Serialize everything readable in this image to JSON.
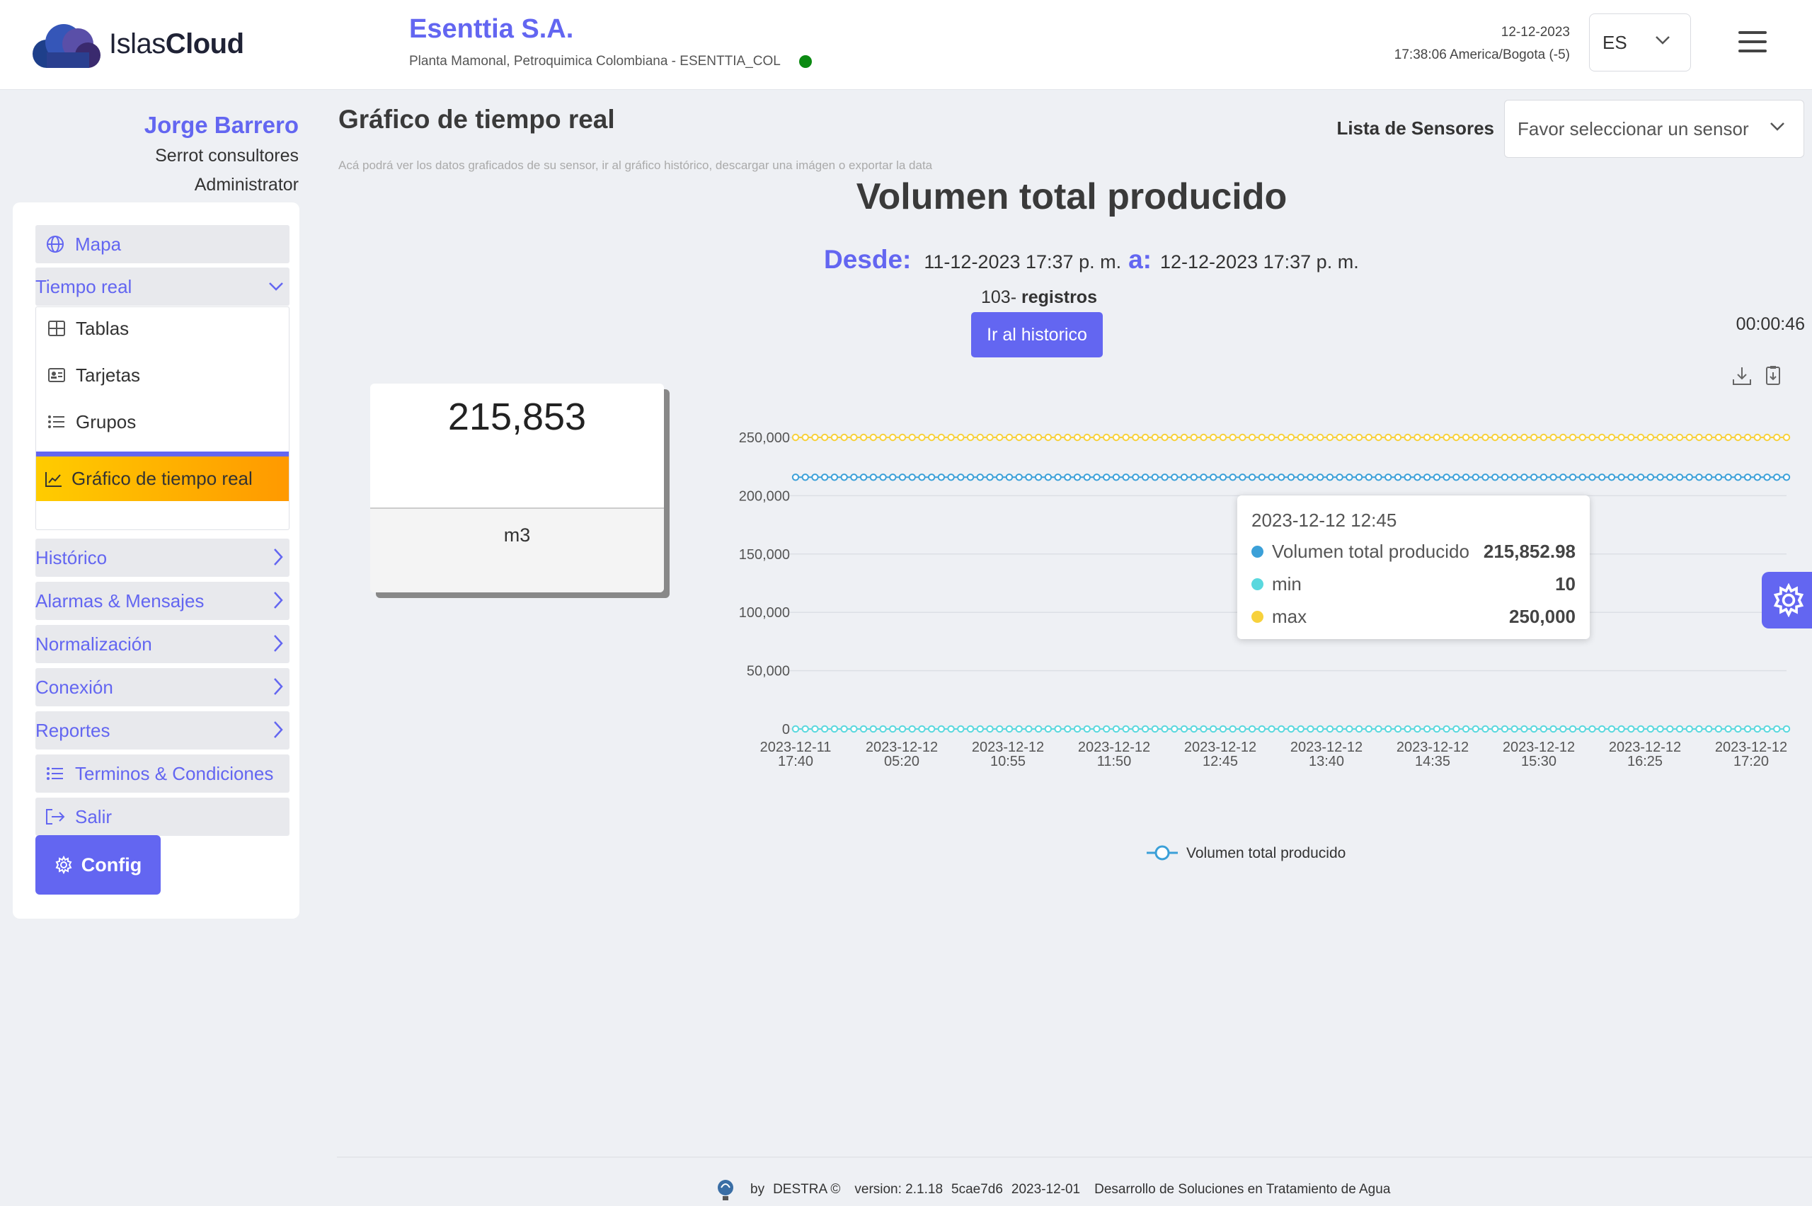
{
  "header": {
    "logo_text_light": "Islas",
    "logo_text_bold": "Cloud",
    "company_name": "Esenttia S.A.",
    "company_sub": "Planta Mamonal, Petroquimica Colombiana - ESENTTIA_COL",
    "status_color": "#0b8a12",
    "date": "12-12-2023",
    "time_tz": "17:38:06 America/Bogota (-5)",
    "language": "ES"
  },
  "user": {
    "name": "Jorge Barrero",
    "company": "Serrot consultores",
    "role": "Administrator"
  },
  "sidebar": {
    "mapa": "Mapa",
    "tiempo_real": "Tiempo real",
    "sub": {
      "tablas": "Tablas",
      "tarjetas": "Tarjetas",
      "grupos": "Grupos",
      "grafico": "Gráfico de tiempo real"
    },
    "historico": "Histórico",
    "alarmas": "Alarmas & Mensajes",
    "normalizacion": "Normalización",
    "conexion": "Conexión",
    "reportes": "Reportes",
    "terminos": "Terminos & Condiciones",
    "salir": "Salir",
    "config": "Config"
  },
  "main": {
    "title": "Gráfico de tiempo real",
    "description": "Acá podrá ver los datos graficados de su sensor, ir al gráfico histórico, descargar una imágen o exportar la data",
    "sensor_label": "Lista de Sensores",
    "sensor_placeholder": "Favor seleccionar un sensor",
    "chart_title": "Volumen total producido",
    "desde_label": "Desde:",
    "desde_value": "11-12-2023 17:37 p. m.",
    "a_label": "a:",
    "a_value": "12-12-2023 17:37 p. m.",
    "records_count": "103-",
    "records_label": "registros",
    "history_button": "Ir al historico",
    "timer": "00:00:46"
  },
  "value_card": {
    "value": "215,853",
    "unit": "m3"
  },
  "tooltip": {
    "time": "2023-12-12 12:45",
    "rows": [
      {
        "label": "Volumen total producido",
        "value": "215,852.98",
        "color": "#3ba0d8"
      },
      {
        "label": "min",
        "value": "10",
        "color": "#5ad8de"
      },
      {
        "label": "max",
        "value": "250,000",
        "color": "#f7d13c"
      }
    ]
  },
  "chart_data": {
    "type": "line",
    "title": "Volumen total producido",
    "x_ticks": [
      [
        "2023-12-11",
        "17:40"
      ],
      [
        "2023-12-12",
        "05:20"
      ],
      [
        "2023-12-12",
        "10:55"
      ],
      [
        "2023-12-12",
        "11:50"
      ],
      [
        "2023-12-12",
        "12:45"
      ],
      [
        "2023-12-12",
        "13:40"
      ],
      [
        "2023-12-12",
        "14:35"
      ],
      [
        "2023-12-12",
        "15:30"
      ],
      [
        "2023-12-12",
        "16:25"
      ],
      [
        "2023-12-12",
        "17:20"
      ]
    ],
    "y_ticks": [
      "0",
      "50,000",
      "100,000",
      "150,000",
      "200,000",
      "250,000"
    ],
    "ylim": [
      0,
      250000
    ],
    "points_per_series": 103,
    "series": [
      {
        "name": "Volumen total producido",
        "value": 215852.98,
        "color": "#3ba0d8"
      },
      {
        "name": "min",
        "value": 10,
        "color": "#5ad8de"
      },
      {
        "name": "max",
        "value": 250000,
        "color": "#f7d13c"
      }
    ],
    "legend": "Volumen total producido",
    "legend_position": "bottom-center",
    "grid": true
  },
  "footer": {
    "by": "by",
    "brand": "DESTRA ©",
    "version": "version: 2.1.18",
    "commit": "5cae7d6",
    "date": "2023-12-01",
    "tagline": "Desarrollo de Soluciones en Tratamiento de Agua"
  }
}
